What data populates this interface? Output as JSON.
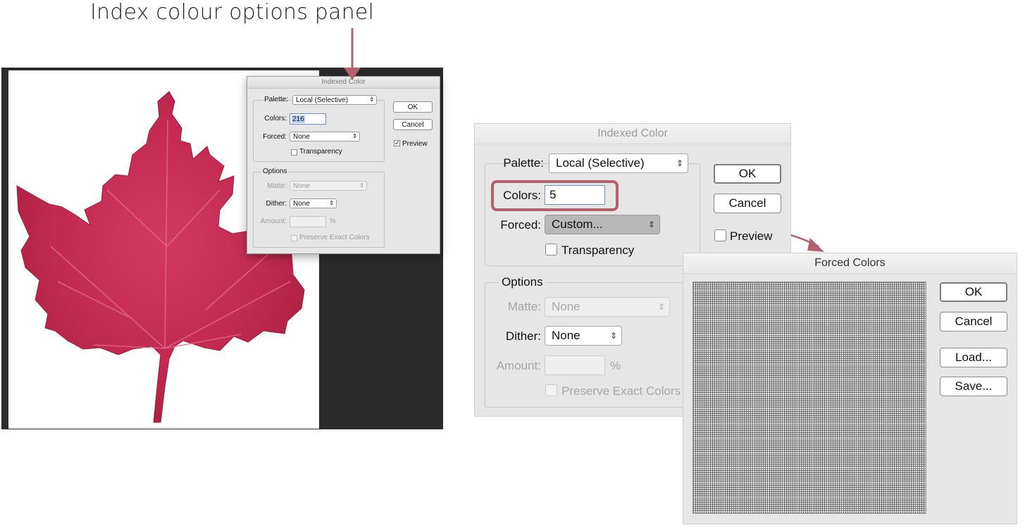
{
  "annotation": {
    "title": "Index colour options panel"
  },
  "small_dialog": {
    "title": "Indexed Color",
    "palette_label": "Palette:",
    "palette_value": "Local (Selective)",
    "colors_label": "Colors:",
    "colors_value": "216",
    "forced_label": "Forced:",
    "forced_value": "None",
    "transparency_label": "Transparency",
    "options_legend": "Options",
    "matte_label": "Matte:",
    "matte_value": "None",
    "dither_label": "Dither:",
    "dither_value": "None",
    "amount_label": "Amount:",
    "amount_unit": "%",
    "preserve_label": "Preserve Exact Colors",
    "ok_label": "OK",
    "cancel_label": "Cancel",
    "preview_label": "Preview",
    "preview_checked": "✓"
  },
  "large_dialog": {
    "title": "Indexed Color",
    "palette_label": "Palette:",
    "palette_value": "Local (Selective)",
    "colors_label": "Colors:",
    "colors_value": "5",
    "forced_label": "Forced:",
    "forced_value": "Custom...",
    "transparency_label": "Transparency",
    "options_legend": "Options",
    "matte_label": "Matte:",
    "matte_value": "None",
    "dither_label": "Dither:",
    "dither_value": "None",
    "amount_label": "Amount:",
    "amount_unit": "%",
    "preserve_label": "Preserve Exact Colors",
    "ok_label": "OK",
    "cancel_label": "Cancel",
    "preview_label": "Preview"
  },
  "forced_dialog": {
    "title": "Forced Colors",
    "ok_label": "OK",
    "cancel_label": "Cancel",
    "load_label": "Load...",
    "save_label": "Save..."
  },
  "colors": {
    "leaf": "#c42d55",
    "annotation_arrow": "#b2606e",
    "workspace": "#2b2b2b"
  }
}
